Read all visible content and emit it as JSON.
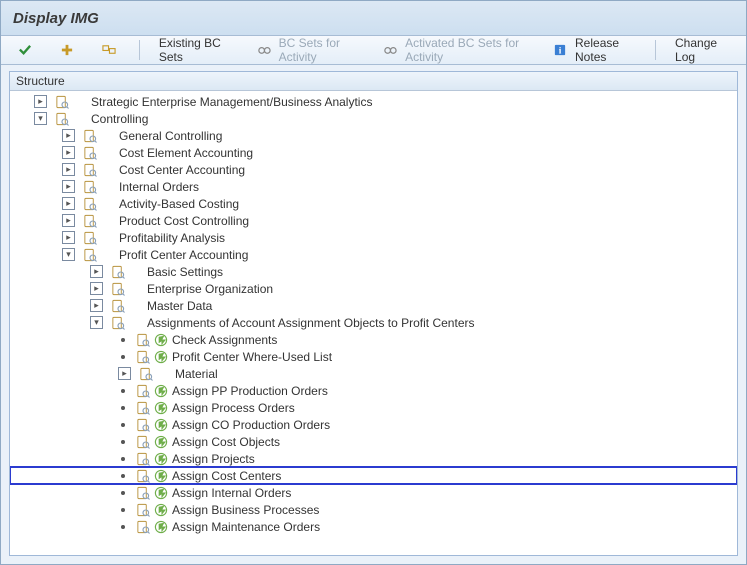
{
  "title": "Display IMG",
  "toolbar": {
    "existing_bc": "Existing BC Sets",
    "bc_for_activity": "BC Sets for Activity",
    "activated_bc": "Activated BC Sets for Activity",
    "release_notes": "Release Notes",
    "change_log": "Change Log"
  },
  "header": "Structure",
  "tree": [
    {
      "depth": 0,
      "exp": "closed",
      "icons": [
        "doc"
      ],
      "label": "Strategic Enterprise Management/Business Analytics"
    },
    {
      "depth": 0,
      "exp": "open",
      "icons": [
        "doc"
      ],
      "label": "Controlling"
    },
    {
      "depth": 1,
      "exp": "closed",
      "icons": [
        "doc"
      ],
      "label": "General Controlling"
    },
    {
      "depth": 1,
      "exp": "closed",
      "icons": [
        "doc"
      ],
      "label": "Cost Element Accounting"
    },
    {
      "depth": 1,
      "exp": "closed",
      "icons": [
        "doc"
      ],
      "label": "Cost Center Accounting"
    },
    {
      "depth": 1,
      "exp": "closed",
      "icons": [
        "doc"
      ],
      "label": "Internal Orders"
    },
    {
      "depth": 1,
      "exp": "closed",
      "icons": [
        "doc"
      ],
      "label": "Activity-Based Costing"
    },
    {
      "depth": 1,
      "exp": "closed",
      "icons": [
        "doc"
      ],
      "label": "Product Cost Controlling"
    },
    {
      "depth": 1,
      "exp": "closed",
      "icons": [
        "doc"
      ],
      "label": "Profitability Analysis"
    },
    {
      "depth": 1,
      "exp": "open",
      "icons": [
        "doc"
      ],
      "label": "Profit Center Accounting"
    },
    {
      "depth": 2,
      "exp": "closed",
      "icons": [
        "doc"
      ],
      "label": "Basic Settings"
    },
    {
      "depth": 2,
      "exp": "closed",
      "icons": [
        "doc"
      ],
      "label": "Enterprise Organization"
    },
    {
      "depth": 2,
      "exp": "closed",
      "icons": [
        "doc"
      ],
      "label": "Master Data"
    },
    {
      "depth": 2,
      "exp": "open",
      "icons": [
        "doc"
      ],
      "label": "Assignments of Account Assignment Objects to Profit Centers"
    },
    {
      "depth": 3,
      "exp": "leaf",
      "icons": [
        "doc",
        "act"
      ],
      "label": "Check Assignments"
    },
    {
      "depth": 3,
      "exp": "leaf",
      "icons": [
        "doc",
        "act"
      ],
      "label": "Profit Center Where-Used List"
    },
    {
      "depth": 3,
      "exp": "closed",
      "icons": [
        "doc"
      ],
      "label": "Material"
    },
    {
      "depth": 3,
      "exp": "leaf",
      "icons": [
        "doc",
        "act"
      ],
      "label": "Assign PP Production Orders"
    },
    {
      "depth": 3,
      "exp": "leaf",
      "icons": [
        "doc",
        "act"
      ],
      "label": "Assign Process Orders"
    },
    {
      "depth": 3,
      "exp": "leaf",
      "icons": [
        "doc",
        "act"
      ],
      "label": "Assign CO Production Orders"
    },
    {
      "depth": 3,
      "exp": "leaf",
      "icons": [
        "doc",
        "act"
      ],
      "label": "Assign Cost Objects"
    },
    {
      "depth": 3,
      "exp": "leaf",
      "icons": [
        "doc",
        "act"
      ],
      "label": "Assign Projects"
    },
    {
      "depth": 3,
      "exp": "leaf",
      "icons": [
        "doc",
        "act"
      ],
      "label": "Assign Cost Centers",
      "highlight": true
    },
    {
      "depth": 3,
      "exp": "leaf",
      "icons": [
        "doc",
        "act"
      ],
      "label": "Assign Internal Orders"
    },
    {
      "depth": 3,
      "exp": "leaf",
      "icons": [
        "doc",
        "act"
      ],
      "label": "Assign Business Processes"
    },
    {
      "depth": 3,
      "exp": "leaf",
      "icons": [
        "doc",
        "act"
      ],
      "label": "Assign Maintenance Orders"
    }
  ]
}
